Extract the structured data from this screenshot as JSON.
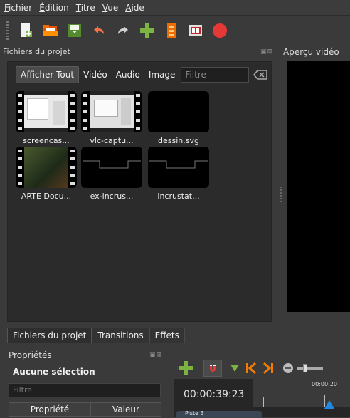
{
  "menu": {
    "items": [
      {
        "label": "Fichier"
      },
      {
        "label": "Édition"
      },
      {
        "label": "Titre"
      },
      {
        "label": "Vue"
      },
      {
        "label": "Aide"
      }
    ]
  },
  "toolbar": {
    "icons": [
      "new-project-icon",
      "open-project-icon",
      "save-project-icon",
      "undo-icon",
      "redo-icon",
      "import-files-icon",
      "choose-profile-icon",
      "fullscreen-icon",
      "export-video-icon"
    ]
  },
  "files": {
    "title": "Fichiers du projet",
    "filter_buttons": [
      "Afficher Tout",
      "Vidéo",
      "Audio",
      "Image"
    ],
    "filter_placeholder": "Filtre",
    "items": [
      {
        "label": "screencas..."
      },
      {
        "label": "vlc-captu..."
      },
      {
        "label": "dessin.svg"
      },
      {
        "label": "ARTE Docu..."
      },
      {
        "label": "ex-incrus..."
      },
      {
        "label": "incrustat..."
      }
    ]
  },
  "preview": {
    "title": "Aperçu vidéo"
  },
  "tabs": [
    "Fichiers du projet",
    "Transitions",
    "Effets"
  ],
  "properties": {
    "title": "Propriétés",
    "selection": "Aucune sélection",
    "filter_placeholder": "Filtre",
    "col_property": "Propriété",
    "col_value": "Valeur"
  },
  "timeline": {
    "timecode": "00:00:39:23",
    "ruler_time": "00:00:20",
    "track_label": "Piste 3"
  },
  "colors": {
    "background": "#3a3a3a",
    "panel": "#2b2b2b",
    "accent_green": "#8bc34a",
    "accent_orange": "#f57c00",
    "record_red": "#e53935"
  }
}
